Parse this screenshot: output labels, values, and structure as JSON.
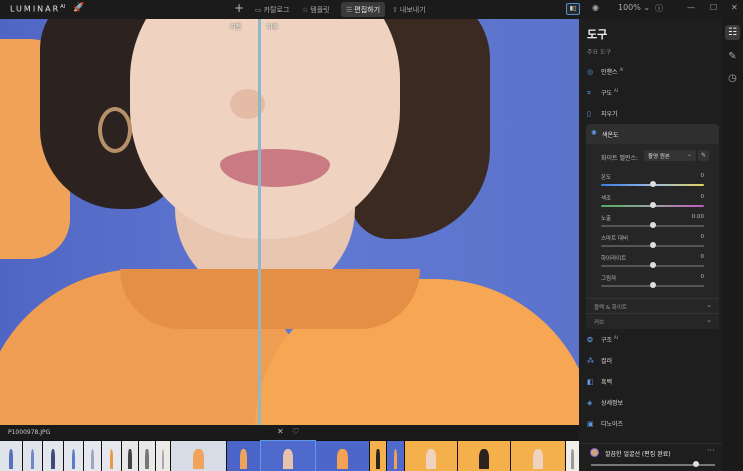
{
  "app": {
    "brand": "LUMINAR",
    "brand_suffix": "AI"
  },
  "nav": {
    "tabs": [
      {
        "label": "카탈로그",
        "icon": "folder-icon"
      },
      {
        "label": "템플릿",
        "icon": "star-icon"
      },
      {
        "label": "편집하기",
        "icon": "sliders-icon",
        "active": true
      },
      {
        "label": "내보내기",
        "icon": "share-icon"
      }
    ]
  },
  "toolbar": {
    "zoom": "100%"
  },
  "canvas": {
    "before_label": "이전",
    "after_label": "이후"
  },
  "panel": {
    "title": "도구",
    "subtitle": "주요 도구",
    "tools_top": [
      {
        "label": "인핸스",
        "badge": "AI",
        "icon": "enhance-icon"
      },
      {
        "label": "구도",
        "badge": "AI",
        "icon": "crop-icon"
      },
      {
        "label": "지우기",
        "icon": "eraser-icon"
      }
    ],
    "color_section": {
      "title": "색온도",
      "wb_label": "화이트 밸런스:",
      "wb_value": "촬영 원본",
      "sliders": [
        {
          "label": "온도",
          "value": "0",
          "fraction": 0.5,
          "track": "temp"
        },
        {
          "label": "색조",
          "value": "0",
          "fraction": 0.5,
          "track": "tint"
        },
        {
          "label": "노출",
          "value": "0.00",
          "fraction": 0.5,
          "track": "plain"
        },
        {
          "label": "스마트 대비",
          "value": "0",
          "fraction": 0.5,
          "track": "plain"
        },
        {
          "label": "하이라이트",
          "value": "0",
          "fraction": 0.5,
          "track": "plain"
        },
        {
          "label": "그림자",
          "value": "0",
          "fraction": 0.5,
          "track": "plain"
        }
      ],
      "collapsed": [
        "블랙 & 화이트",
        "커브"
      ]
    },
    "tools_bottom": [
      {
        "label": "구조",
        "badge": "AI",
        "icon": "structure-icon"
      },
      {
        "label": "컬러",
        "icon": "color-icon"
      },
      {
        "label": "흑백",
        "icon": "bw-icon"
      },
      {
        "label": "상세정보",
        "icon": "details-icon"
      },
      {
        "label": "디노이즈",
        "icon": "denoise-icon"
      }
    ]
  },
  "preset": {
    "name": "깔끔한 얼굴선 (편집 완료)",
    "amount": 0.85
  },
  "filmstrip": {
    "filename": "P1000978.JPG"
  },
  "colors": {
    "accent": "#5d9be8",
    "backdrop": "#5b72c9",
    "sweater": "#f7a653"
  }
}
